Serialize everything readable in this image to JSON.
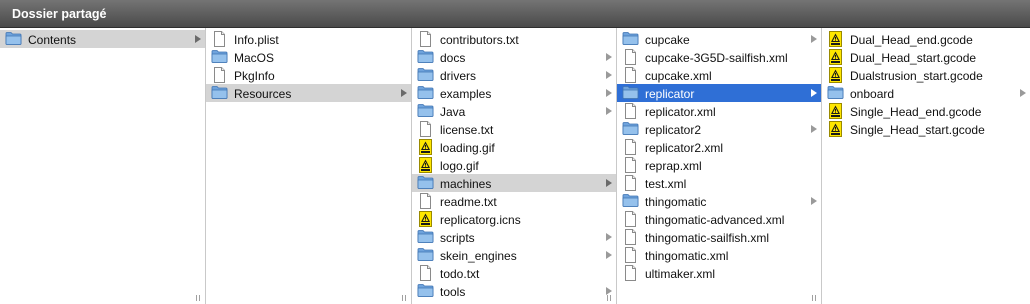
{
  "window": {
    "title": "Dossier partagé"
  },
  "columns": [
    {
      "items": [
        {
          "label": "Contents",
          "type": "folder",
          "arrow": true,
          "state": "sel"
        }
      ]
    },
    {
      "items": [
        {
          "label": "Info.plist",
          "type": "doc"
        },
        {
          "label": "MacOS",
          "type": "folder"
        },
        {
          "label": "PkgInfo",
          "type": "doc"
        },
        {
          "label": "Resources",
          "type": "folder",
          "arrow": true,
          "state": "sel"
        }
      ]
    },
    {
      "items": [
        {
          "label": "contributors.txt",
          "type": "doc"
        },
        {
          "label": "docs",
          "type": "folder",
          "arrow": true
        },
        {
          "label": "drivers",
          "type": "folder",
          "arrow": true
        },
        {
          "label": "examples",
          "type": "folder",
          "arrow": true
        },
        {
          "label": "Java",
          "type": "folder",
          "arrow": true
        },
        {
          "label": "license.txt",
          "type": "doc"
        },
        {
          "label": "loading.gif",
          "type": "warn"
        },
        {
          "label": "logo.gif",
          "type": "warn"
        },
        {
          "label": "machines",
          "type": "folder",
          "arrow": true,
          "state": "sel"
        },
        {
          "label": "readme.txt",
          "type": "doc"
        },
        {
          "label": "replicatorg.icns",
          "type": "warn"
        },
        {
          "label": "scripts",
          "type": "folder",
          "arrow": true
        },
        {
          "label": "skein_engines",
          "type": "folder",
          "arrow": true
        },
        {
          "label": "todo.txt",
          "type": "doc"
        },
        {
          "label": "tools",
          "type": "folder",
          "arrow": true
        }
      ]
    },
    {
      "items": [
        {
          "label": "cupcake",
          "type": "folder",
          "arrow": true
        },
        {
          "label": "cupcake-3G5D-sailfish.xml",
          "type": "doc"
        },
        {
          "label": "cupcake.xml",
          "type": "doc"
        },
        {
          "label": "replicator",
          "type": "folder",
          "arrow": true,
          "state": "active"
        },
        {
          "label": "replicator.xml",
          "type": "doc"
        },
        {
          "label": "replicator2",
          "type": "folder",
          "arrow": true
        },
        {
          "label": "replicator2.xml",
          "type": "doc"
        },
        {
          "label": "reprap.xml",
          "type": "doc"
        },
        {
          "label": "test.xml",
          "type": "doc"
        },
        {
          "label": "thingomatic",
          "type": "folder",
          "arrow": true
        },
        {
          "label": "thingomatic-advanced.xml",
          "type": "doc"
        },
        {
          "label": "thingomatic-sailfish.xml",
          "type": "doc"
        },
        {
          "label": "thingomatic.xml",
          "type": "doc"
        },
        {
          "label": "ultimaker.xml",
          "type": "doc"
        }
      ]
    },
    {
      "items": [
        {
          "label": "Dual_Head_end.gcode",
          "type": "warn"
        },
        {
          "label": "Dual_Head_start.gcode",
          "type": "warn"
        },
        {
          "label": "Dualstrusion_start.gcode",
          "type": "warn"
        },
        {
          "label": "onboard",
          "type": "folder",
          "arrow": true
        },
        {
          "label": "Single_Head_end.gcode",
          "type": "warn"
        },
        {
          "label": "Single_Head_start.gcode",
          "type": "warn"
        }
      ]
    }
  ],
  "icons": {
    "folder": "folder-icon",
    "doc": "document-icon",
    "warn": "warning-file-icon",
    "arrow": "chevron-right-icon",
    "resize": "column-resize-icon"
  },
  "colors": {
    "titlebar": "#4a4a4a",
    "selection_active": "#2f6fd6",
    "selection_inactive": "#d4d4d4",
    "folder_blue": "#7fb1e3"
  }
}
